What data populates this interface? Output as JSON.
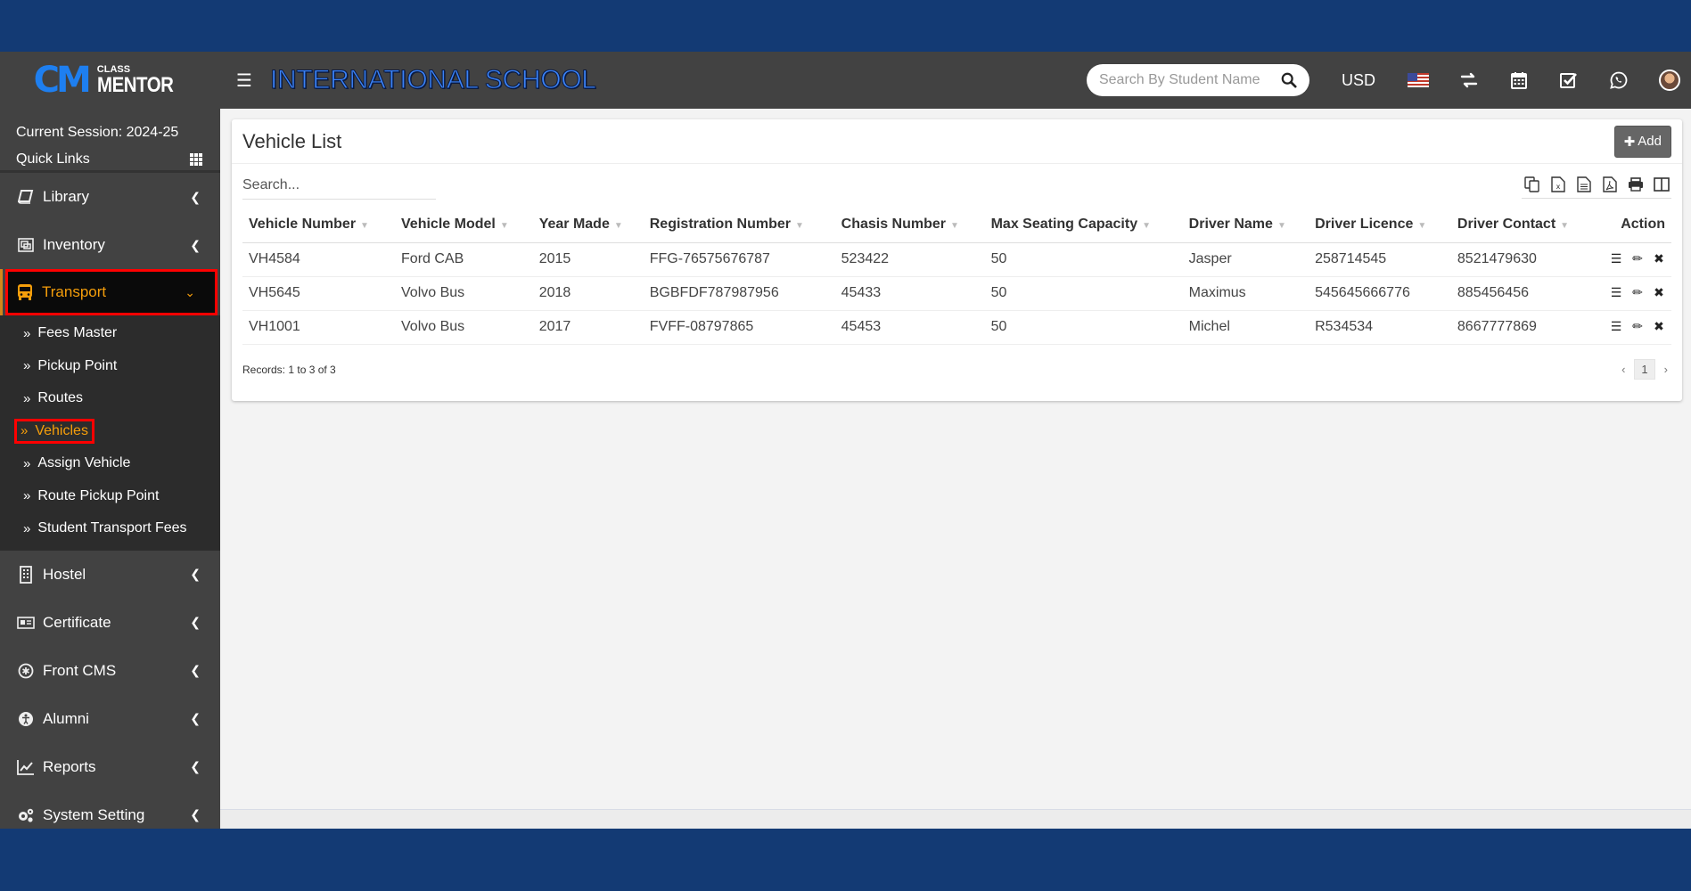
{
  "header": {
    "logo_mark": "CM",
    "logo_small": "CLASS",
    "logo_big": "MENTOR",
    "school_name": "INTERNATIONAL SCHOOL",
    "search_placeholder": "Search By Student Name",
    "currency": "USD",
    "icons": [
      "menu-icon",
      "search-icon",
      "us-flag-icon",
      "swap-icon",
      "calendar-icon",
      "check-square-icon",
      "whatsapp-icon",
      "user-avatar"
    ]
  },
  "sidebar": {
    "session": "Current Session: 2024-25",
    "quick_links": "Quick Links",
    "items_top": [
      {
        "label": "Library",
        "icon": "book-icon"
      },
      {
        "label": "Inventory",
        "icon": "inventory-icon"
      }
    ],
    "active": {
      "label": "Transport",
      "icon": "bus-icon"
    },
    "submenu": [
      {
        "label": "Fees Master"
      },
      {
        "label": "Pickup Point"
      },
      {
        "label": "Routes"
      },
      {
        "label": "Vehicles",
        "active": true
      },
      {
        "label": "Assign Vehicle"
      },
      {
        "label": "Route Pickup Point"
      },
      {
        "label": "Student Transport Fees"
      }
    ],
    "items_bottom": [
      {
        "label": "Hostel",
        "icon": "building-icon"
      },
      {
        "label": "Certificate",
        "icon": "certificate-icon"
      },
      {
        "label": "Front CMS",
        "icon": "cms-icon"
      },
      {
        "label": "Alumni",
        "icon": "alumni-icon"
      },
      {
        "label": "Reports",
        "icon": "chart-line-icon"
      },
      {
        "label": "System Setting",
        "icon": "gears-icon"
      }
    ]
  },
  "main": {
    "title": "Vehicle List",
    "add_label": "Add",
    "search_placeholder": "Search...",
    "export_icons": [
      "copy-icon",
      "excel-icon",
      "csv-icon",
      "pdf-icon",
      "print-icon",
      "columns-icon"
    ],
    "columns": [
      "Vehicle Number",
      "Vehicle Model",
      "Year Made",
      "Registration Number",
      "Chasis Number",
      "Max Seating Capacity",
      "Driver Name",
      "Driver Licence",
      "Driver Contact",
      "Action"
    ],
    "rows": [
      [
        "VH4584",
        "Ford CAB",
        "2015",
        "FFG-76575676787",
        "523422",
        "50",
        "Jasper",
        "258714545",
        "8521479630"
      ],
      [
        "VH5645",
        "Volvo Bus",
        "2018",
        "BGBFDF787987956",
        "45433",
        "50",
        "Maximus",
        "545645666776",
        "885456456"
      ],
      [
        "VH1001",
        "Volvo Bus",
        "2017",
        "FVFF-08797865",
        "45453",
        "50",
        "Michel",
        "R534534",
        "8667777869"
      ]
    ],
    "records": "Records: 1 to 3 of 3",
    "pager": {
      "prev": "‹",
      "current": "1",
      "next": "›"
    }
  }
}
